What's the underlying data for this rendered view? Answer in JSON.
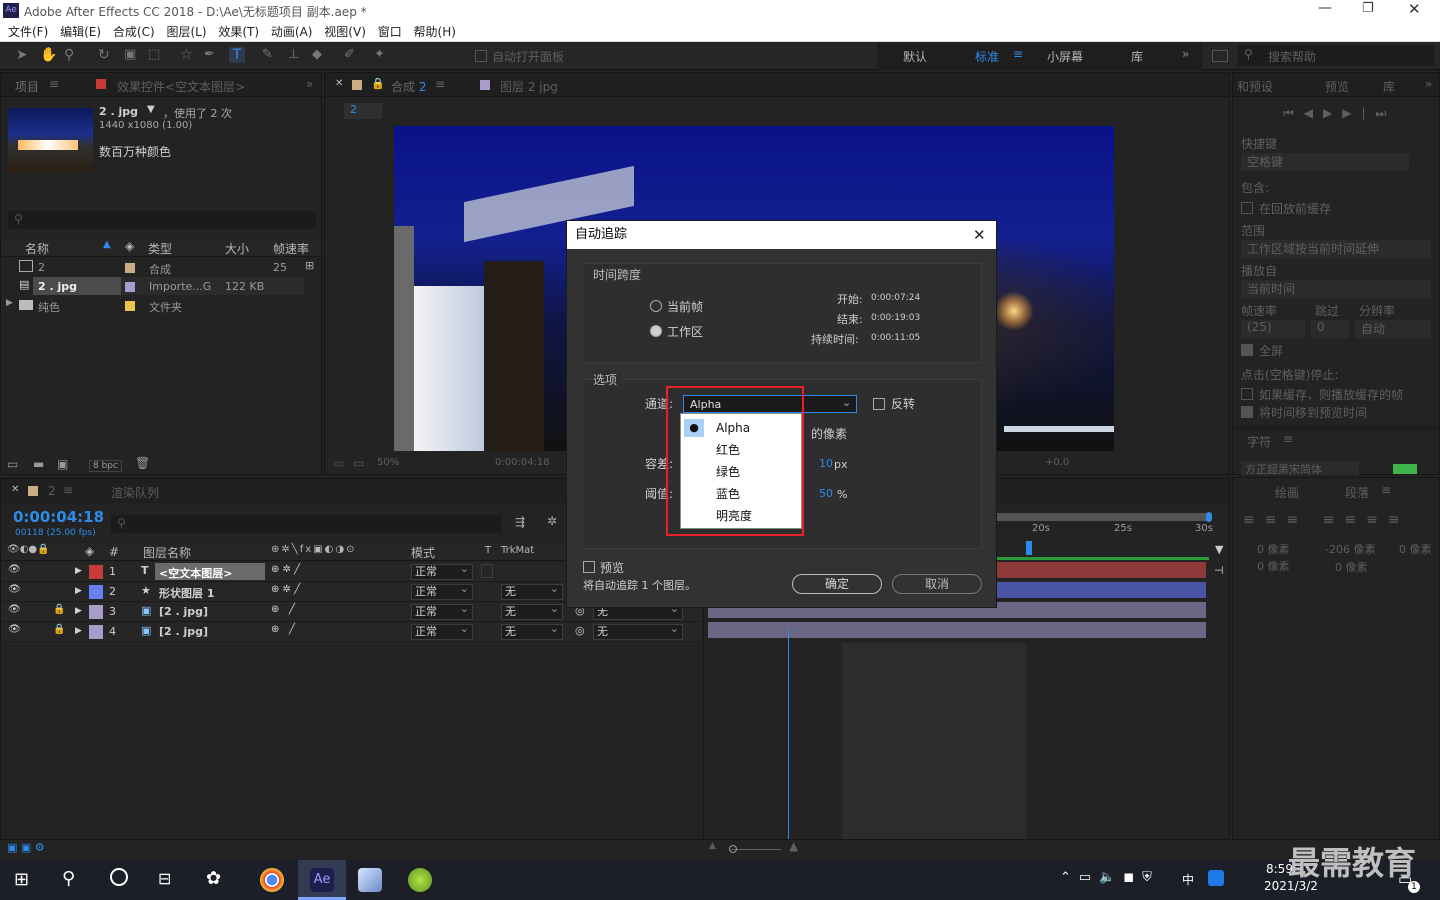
{
  "window": {
    "title": "Adobe After Effects CC 2018 - D:\\Ae\\无标题项目 副本.aep *"
  },
  "menu": [
    "文件(F)",
    "编辑(E)",
    "合成(C)",
    "图层(L)",
    "效果(T)",
    "动画(A)",
    "视图(V)",
    "窗口",
    "帮助(H)"
  ],
  "toolbar": {
    "auto_open": "自动打开面板",
    "workspaces": [
      "默认",
      "标准",
      "小屏幕",
      "库"
    ],
    "active_workspace": "标准",
    "search_help": "搜索帮助"
  },
  "project": {
    "tab": "项目",
    "effects_tab": "效果控件<空文本图层>",
    "item_name": "2 . jpg",
    "item_used": "，使用了 2 次",
    "item_dims": "1440 x1080 (1.00)",
    "item_colors": "数百万种颜色",
    "cols": [
      "名称",
      "类型",
      "大小",
      "帧速率"
    ],
    "rows": [
      {
        "name": "2",
        "type": "合成",
        "size": "",
        "fps": "25"
      },
      {
        "name": "2 . jpg",
        "type": "Importe...G",
        "size": "122 KB",
        "fps": ""
      },
      {
        "name": "纯色",
        "type": "文件夹",
        "size": "",
        "fps": ""
      }
    ],
    "bpc": "8 bpc"
  },
  "viewer": {
    "tab_comp": "合成 2",
    "tab_layer": "图层 2 jpg",
    "comp_label": "2",
    "zoom": "50%",
    "timecode": "0:00:04:18",
    "exposure": "+0.0"
  },
  "dialog": {
    "title": "自动追踪",
    "timespan_label": "时间跨度",
    "opt_current": "当前帧",
    "opt_workarea": "工作区",
    "start_label": "开始:",
    "start_val": "0:00:07:24",
    "end_label": "结束:",
    "end_val": "0:00:19:03",
    "duration_label": "持续时间:",
    "duration_val": "0:00:11:05",
    "options_label": "选项",
    "channel_label": "通道:",
    "channel_value": "Alpha",
    "invert_label": "反转",
    "pixels_text": "的像素",
    "tolerance_label": "容差:",
    "tolerance_val": "10",
    "tolerance_unit": "px",
    "threshold_label": "阈值:",
    "threshold_val": "50",
    "threshold_unit": "%",
    "preview_label": "预览",
    "status": "将自动追踪 1 个图层。",
    "ok": "确定",
    "cancel": "取消",
    "channel_options": [
      "Alpha",
      "红色",
      "绿色",
      "蓝色",
      "明亮度"
    ]
  },
  "preview_panel": {
    "tabs": [
      "和预设",
      "预览",
      "库"
    ],
    "shortcut_label": "快捷键",
    "shortcut_val": "空格键",
    "include_label": "包含:",
    "cache_label": "在回放前缓存",
    "range_label": "范围",
    "range_val": "工作区域按当前时间延伸",
    "play_from_label": "播放自",
    "play_from_val": "当前时间",
    "fps_label": "帧速率",
    "skip_label": "跳过",
    "res_label": "分辨率",
    "fps_val": "(25)",
    "skip_val": "0",
    "res_val": "自动",
    "fullscreen": "全屏",
    "stop_label": "点击(空格键)停止:",
    "stop_opt1": "如果缓存，则播放缓存的帧",
    "stop_opt2": "将时间移到预览时间",
    "char_tab": "字符",
    "char_val": "方正超黑宋简体"
  },
  "align_panel": {
    "tabs": [
      "绘画",
      "段落"
    ],
    "px1": "0 像素",
    "px2": "-206 像素",
    "px3": "0 像素",
    "px4": "0 像素",
    "px5": "0 像素"
  },
  "timeline": {
    "tab_comp": "2",
    "tab_render": "渲染队列",
    "timecode": "0:00:04:18",
    "frames": "00118 (25.00 fps)",
    "col_layer": "图层名称",
    "col_mode": "模式",
    "col_t": "T",
    "col_trkmat": "TrkMat",
    "ruler": [
      "20s",
      "25s",
      "30s"
    ],
    "layers": [
      {
        "num": "1",
        "name": "<空文本图层>",
        "mode": "正常",
        "trk": "",
        "color": "#c83a3a",
        "kind": "T"
      },
      {
        "num": "2",
        "name": "形状图层 1",
        "mode": "正常",
        "trk": "无",
        "color": "#6a7ef0",
        "kind": "★"
      },
      {
        "num": "3",
        "name": "[2 . jpg]",
        "mode": "正常",
        "trk": "无",
        "color": "#a99ccc",
        "kind": "▣"
      },
      {
        "num": "4",
        "name": "[2 . jpg]",
        "mode": "正常",
        "trk": "无",
        "color": "#a99ccc",
        "kind": "▣"
      }
    ],
    "parent3": "无",
    "parent4": "无"
  },
  "taskbar": {
    "time": "8:59",
    "date": "2021/3/2",
    "ime": "中",
    "watermark": "最需教育",
    "notifications": "1"
  }
}
